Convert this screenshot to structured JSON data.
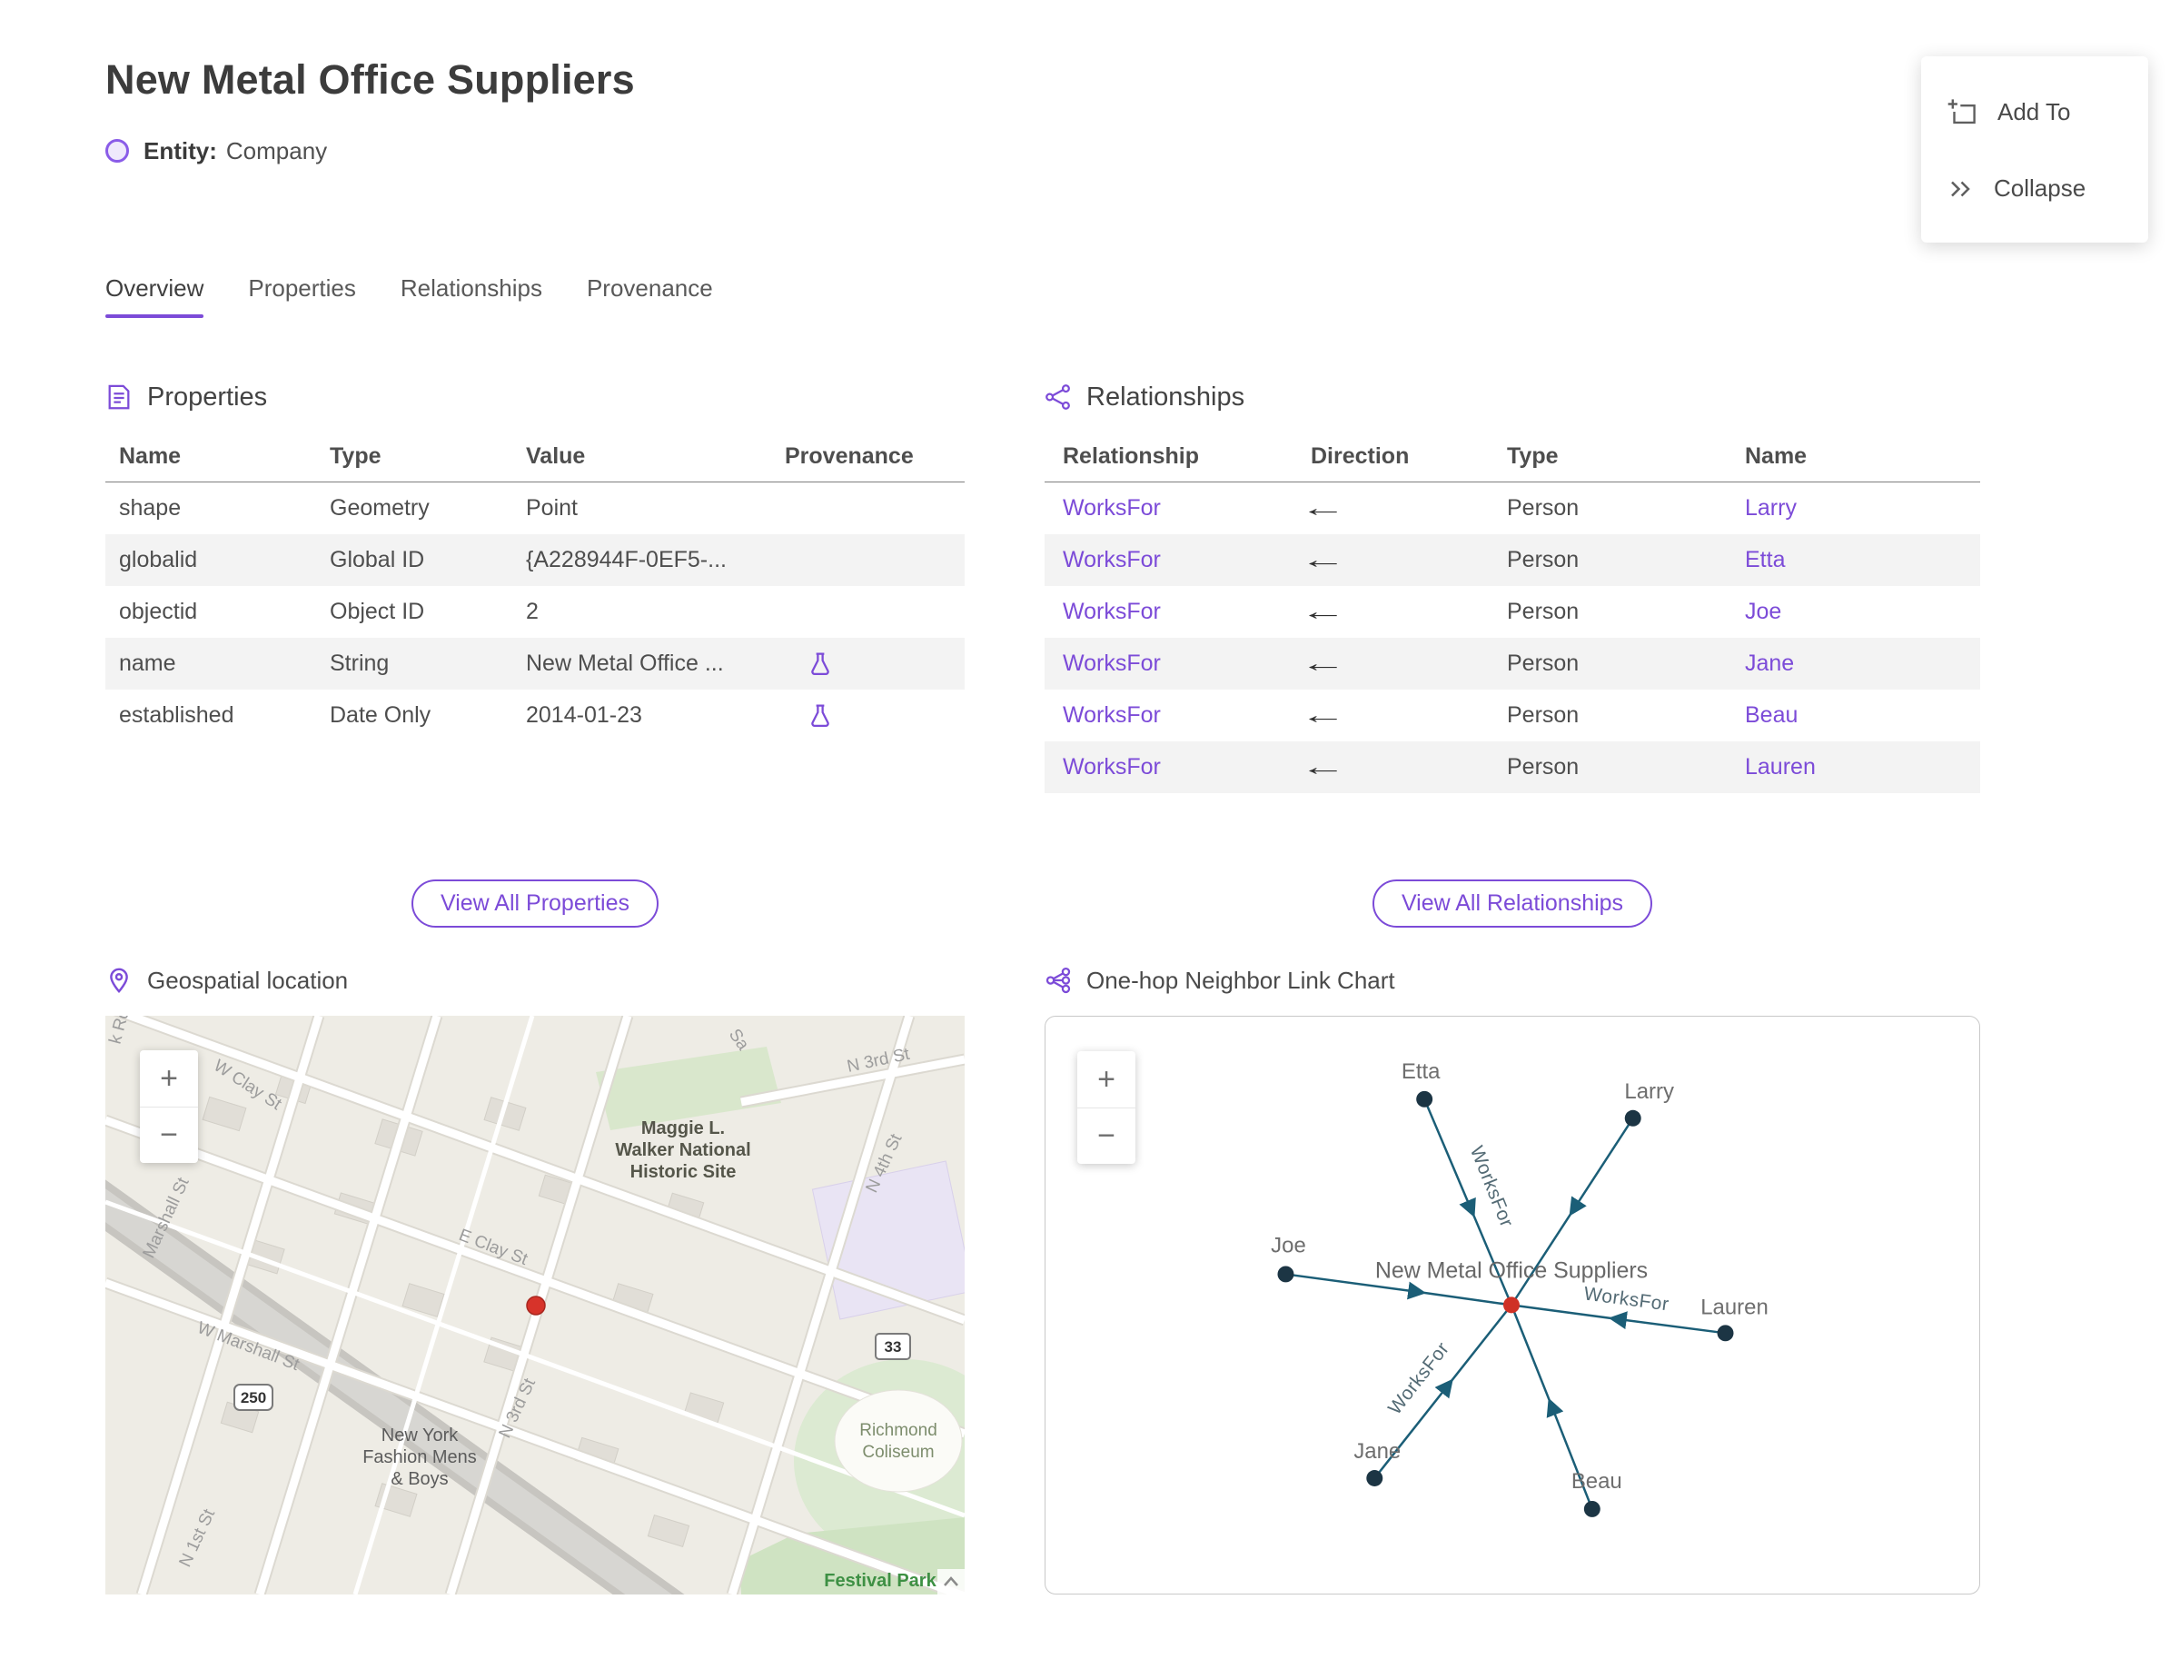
{
  "header": {
    "title": "New Metal Office Suppliers",
    "entity_label": "Entity:",
    "entity_type": "Company"
  },
  "menu": {
    "add_to": "Add To",
    "collapse": "Collapse"
  },
  "tabs": [
    {
      "label": "Overview",
      "active": true
    },
    {
      "label": "Properties",
      "active": false
    },
    {
      "label": "Relationships",
      "active": false
    },
    {
      "label": "Provenance",
      "active": false
    }
  ],
  "properties": {
    "section_title": "Properties",
    "columns": [
      "Name",
      "Type",
      "Value",
      "Provenance"
    ],
    "rows": [
      {
        "name": "shape",
        "type": "Geometry",
        "value": "Point",
        "provenance": false
      },
      {
        "name": "globalid",
        "type": "Global ID",
        "value": "{A228944F-0EF5-...",
        "provenance": false
      },
      {
        "name": "objectid",
        "type": "Object ID",
        "value": "2",
        "provenance": false
      },
      {
        "name": "name",
        "type": "String",
        "value": "New Metal Office ...",
        "provenance": true
      },
      {
        "name": "established",
        "type": "Date Only",
        "value": "2014-01-23",
        "provenance": true
      }
    ],
    "view_all_label": "View All Properties"
  },
  "relationships": {
    "section_title": "Relationships",
    "columns": [
      "Relationship",
      "Direction",
      "Type",
      "Name"
    ],
    "rows": [
      {
        "relationship": "WorksFor",
        "direction": "←",
        "type": "Person",
        "name": "Larry"
      },
      {
        "relationship": "WorksFor",
        "direction": "←",
        "type": "Person",
        "name": "Etta"
      },
      {
        "relationship": "WorksFor",
        "direction": "←",
        "type": "Person",
        "name": "Joe"
      },
      {
        "relationship": "WorksFor",
        "direction": "←",
        "type": "Person",
        "name": "Jane"
      },
      {
        "relationship": "WorksFor",
        "direction": "←",
        "type": "Person",
        "name": "Beau"
      },
      {
        "relationship": "WorksFor",
        "direction": "←",
        "type": "Person",
        "name": "Lauren"
      }
    ],
    "view_all_label": "View All Relationships"
  },
  "map": {
    "section_title": "Geospatial location",
    "zoom_in": "+",
    "zoom_out": "−",
    "streets": {
      "k_rd": "k Rd",
      "w_clay": "W Clay St",
      "sa": "Sa",
      "n3_top": "N 3rd St",
      "n4": "N 4th St",
      "marshall": "Marshall St",
      "e_clay": "E Clay St",
      "w_marshall": "W Marshall St",
      "n3": "N 3rd St",
      "n1": "N 1st St"
    },
    "places": {
      "historic_1": "Maggie L.",
      "historic_2": "Walker National",
      "historic_3": "Historic Site",
      "fashion_1": "New York",
      "fashion_2": "Fashion Mens",
      "fashion_3": "& Boys",
      "coliseum_1": "Richmond",
      "coliseum_2": "Coliseum",
      "festival_park": "Festival Park"
    },
    "route_shields": {
      "us250": "250",
      "va33": "33"
    }
  },
  "link_chart": {
    "section_title": "One-hop Neighbor Link Chart",
    "zoom_in": "+",
    "zoom_out": "−",
    "center_node": "New Metal Office Suppliers",
    "edge_label": "WorksFor",
    "neighbors": [
      "Etta",
      "Larry",
      "Joe",
      "Jane",
      "Beau",
      "Lauren"
    ]
  },
  "colors": {
    "accent": "#7c4bd8",
    "edge": "#1b5e77",
    "node": "#1c3544",
    "center_node": "#cf3126",
    "stripe": "#f3f3f3"
  }
}
